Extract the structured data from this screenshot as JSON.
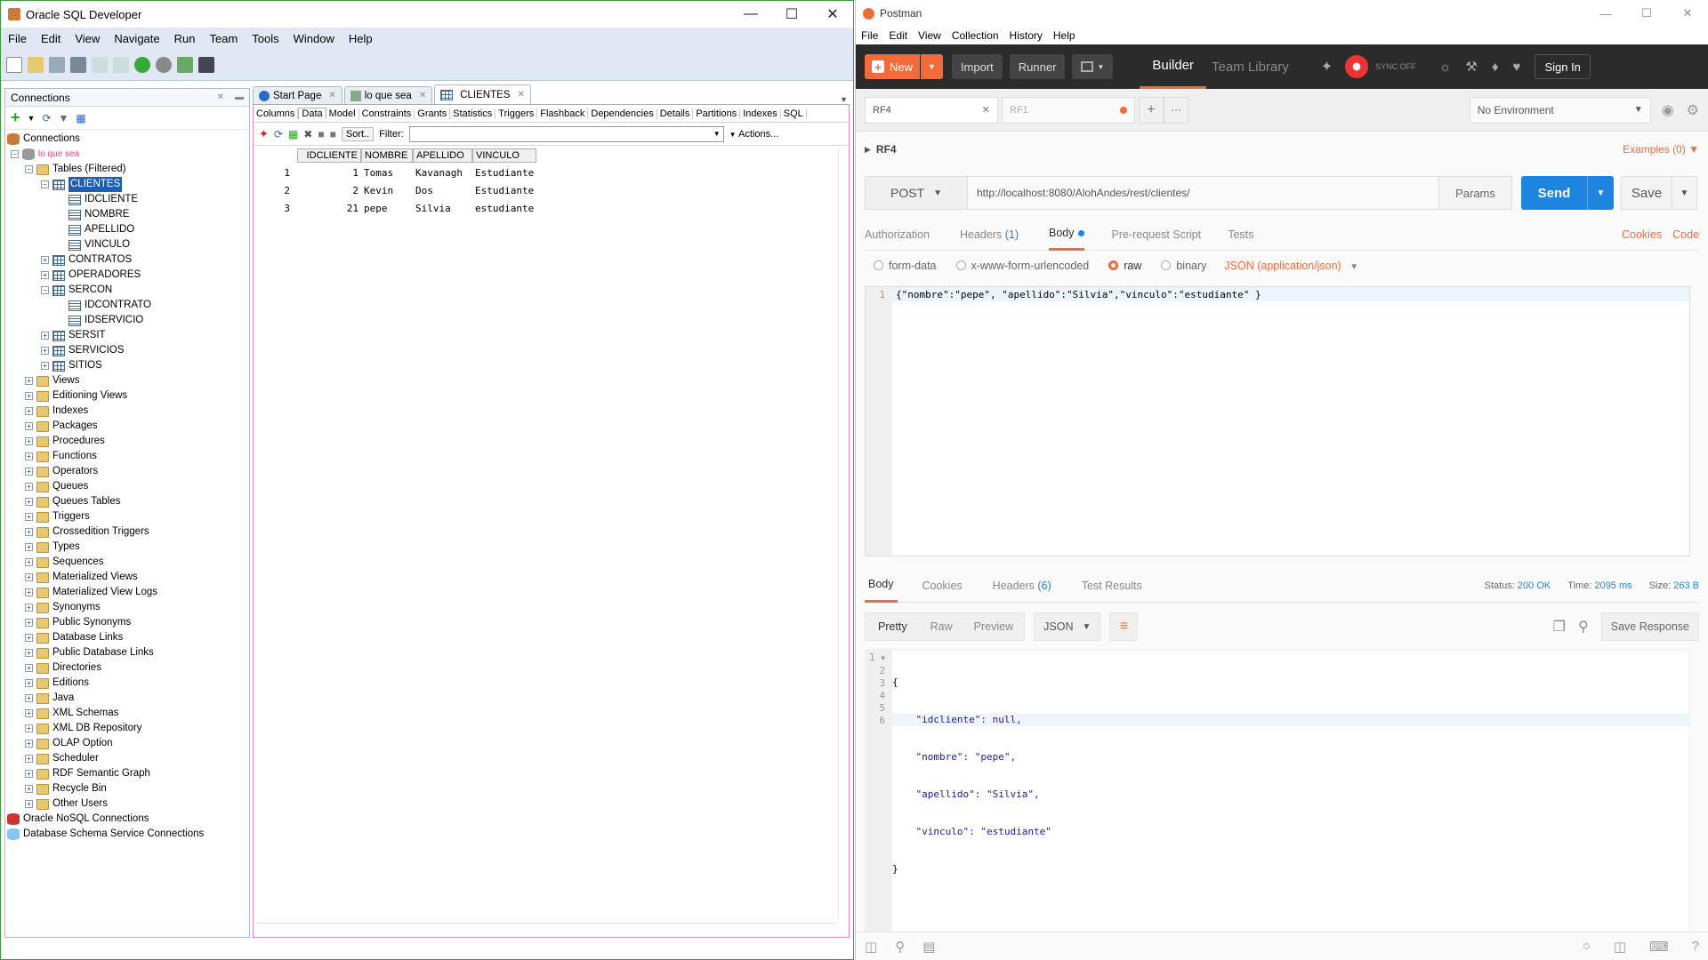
{
  "sqldev": {
    "window_title": "Oracle SQL Developer",
    "menu": [
      "File",
      "Edit",
      "View",
      "Navigate",
      "Run",
      "Team",
      "Tools",
      "Window",
      "Help"
    ],
    "connections_panel_title": "Connections",
    "tree": {
      "root": "Connections",
      "connection": "lo que sea",
      "tables_folder": "Tables (Filtered)",
      "selected_table": "CLIENTES",
      "clientes_columns": [
        "IDCLIENTE",
        "NOMBRE",
        "APELLIDO",
        "VINCULO"
      ],
      "table_contratos": "CONTRATOS",
      "table_operadores": "OPERADORES",
      "table_sercon": "SERCON",
      "sercon_columns": [
        "IDCONTRATO",
        "IDSERVICIO"
      ],
      "other_tables": [
        "SERSIT",
        "SERVICIOS",
        "SITIOS"
      ],
      "folders": [
        "Views",
        "Editioning Views",
        "Indexes",
        "Packages",
        "Procedures",
        "Functions",
        "Operators",
        "Queues",
        "Queues Tables",
        "Triggers",
        "Crossedition Triggers",
        "Types",
        "Sequences",
        "Materialized Views",
        "Materialized View Logs",
        "Synonyms",
        "Public Synonyms",
        "Database Links",
        "Public Database Links",
        "Directories",
        "Editions",
        "Java",
        "XML Schemas",
        "XML DB Repository",
        "OLAP Option",
        "Scheduler",
        "RDF Semantic Graph",
        "Recycle Bin",
        "Other Users"
      ],
      "nosql": "Oracle NoSQL Connections",
      "schema_service": "Database Schema Service Connections"
    },
    "doc_tabs": [
      "Start Page",
      "lo que sea",
      "CLIENTES"
    ],
    "sub_tabs": [
      "Columns",
      "Data",
      "Model",
      "Constraints",
      "Grants",
      "Statistics",
      "Triggers",
      "Flashback",
      "Dependencies",
      "Details",
      "Partitions",
      "Indexes",
      "SQL"
    ],
    "active_sub_tab": "Data",
    "sort_label": "Sort..",
    "filter_label": "Filter:",
    "actions_label": "Actions...",
    "grid": {
      "headers": [
        "IDCLIENTE",
        "NOMBRE",
        "APELLIDO",
        "VINCULO"
      ],
      "rows": [
        {
          "n": "1",
          "id": "1",
          "nombre": "Tomas",
          "apellido": "Kavanagh",
          "vinculo": "Estudiante"
        },
        {
          "n": "2",
          "id": "2",
          "nombre": "Kevin",
          "apellido": "Dos",
          "vinculo": "Estudiante"
        },
        {
          "n": "3",
          "id": "21",
          "nombre": "pepe",
          "apellido": "Silvia",
          "vinculo": "estudiante"
        }
      ]
    }
  },
  "postman": {
    "window_title": "Postman",
    "menu": [
      "File",
      "Edit",
      "View",
      "Collection",
      "History",
      "Help"
    ],
    "new_label": "New",
    "import_label": "Import",
    "runner_label": "Runner",
    "builder_label": "Builder",
    "team_library_label": "Team Library",
    "sync_label": "SYNC OFF",
    "signin_label": "Sign In",
    "req_tabs": [
      "RF4",
      "RF1"
    ],
    "environment": "No Environment",
    "request_name": "RF4",
    "examples_label": "Examples (0)",
    "method": "POST",
    "url": "http://localhost:8080/AlohAndes/rest/clientes/",
    "params_label": "Params",
    "send_label": "Send",
    "save_label": "Save",
    "req_tabs2": {
      "auth": "Authorization",
      "headers": "Headers",
      "headers_count": "(1)",
      "body": "Body",
      "prereq": "Pre-request Script",
      "tests": "Tests"
    },
    "cookies_label": "Cookies",
    "code_label": "Code",
    "body_modes": [
      "form-data",
      "x-www-form-urlencoded",
      "raw",
      "binary"
    ],
    "content_type": "JSON (application/json)",
    "request_body_line": "{\"nombre\":\"pepe\", \"apellido\":\"Silvia\",\"vinculo\":\"estudiante\" }",
    "resp_tabs": {
      "body": "Body",
      "cookies": "Cookies",
      "headers": "Headers",
      "headers_count": "(6)",
      "tests": "Test Results"
    },
    "status_label": "Status:",
    "status_value": "200 OK",
    "time_label": "Time:",
    "time_value": "2095 ms",
    "size_label": "Size:",
    "size_value": "263 B",
    "view_modes": [
      "Pretty",
      "Raw",
      "Preview"
    ],
    "format": "JSON",
    "save_response_label": "Save Response",
    "response_lines": [
      "{",
      "    \"idcliente\": null,",
      "    \"nombre\": \"pepe\",",
      "    \"apellido\": \"Silvia\",",
      "    \"vinculo\": \"estudiante\"",
      "}"
    ]
  }
}
